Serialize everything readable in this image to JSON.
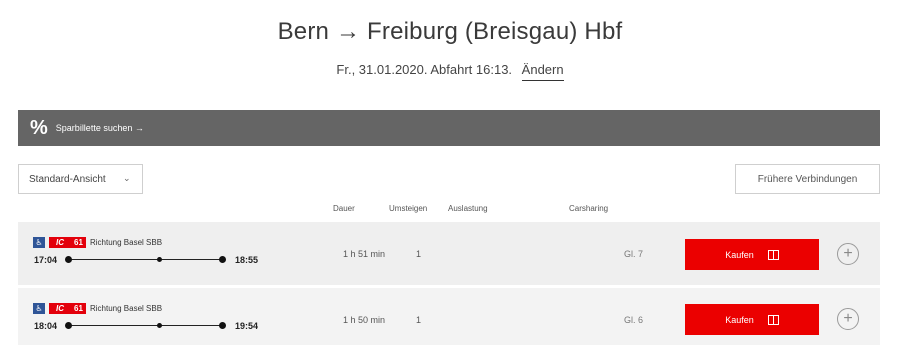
{
  "header": {
    "title": "Bern → Freiburg (Breisgau) Hbf",
    "subtitle": "Fr., 31.01.2020. Abfahrt 16:13.",
    "change_label": "Ändern"
  },
  "saver": {
    "icon": "%",
    "label": "Sparbillette suchen →"
  },
  "controls": {
    "view_select_value": "Standard-Ansicht",
    "earlier_label": "Frühere Verbindungen"
  },
  "columns": {
    "duration": "Dauer",
    "transfers": "Umsteigen",
    "occupancy": "Auslastung",
    "carsharing": "Carsharing"
  },
  "connections": [
    {
      "category": "IC",
      "number": "61",
      "direction": "Richtung Basel SBB",
      "departure": "17:04",
      "arrival": "18:55",
      "duration": "1 h 51 min",
      "transfers": "1",
      "platform": "Gl. 7",
      "buy_label": "Kaufen"
    },
    {
      "category": "IC",
      "number": "61",
      "direction": "Richtung Basel SBB",
      "departure": "18:04",
      "arrival": "19:54",
      "duration": "1 h 50 min",
      "transfers": "1",
      "platform": "Gl. 6",
      "buy_label": "Kaufen"
    }
  ],
  "colors": {
    "accent_red": "#eb0000",
    "saver_bar": "#656565",
    "bus_blue": "#2f5597"
  }
}
